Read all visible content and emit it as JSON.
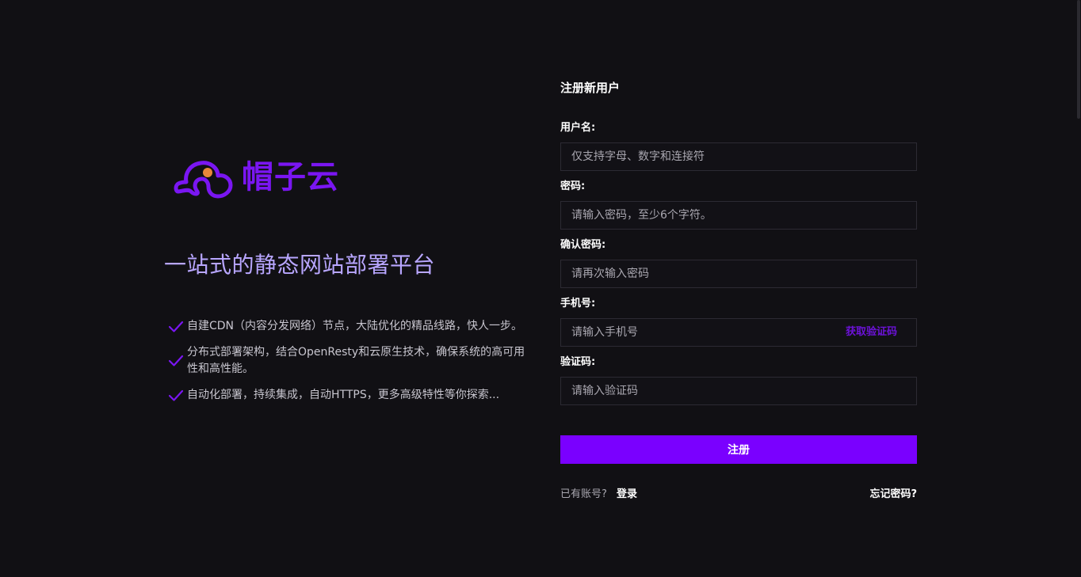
{
  "brand": {
    "name": "帽子云",
    "logo_icon": "cloud-hat-icon",
    "accent_color": "#7a16f2",
    "dot_color": "#e8873a"
  },
  "hero": {
    "headline": "一站式的静态网站部署平台",
    "features": [
      {
        "icon": "check-icon",
        "text": "自建CDN（内容分发网络）节点，大陆优化的精品线路，快人一步。"
      },
      {
        "icon": "check-icon",
        "text": "分布式部署架构，结合OpenResty和云原生技术，确保系统的高可用性和高性能。"
      },
      {
        "icon": "check-icon",
        "text": "自动化部署，持续集成，自动HTTPS，更多高级特性等你探索..."
      }
    ]
  },
  "form": {
    "title": "注册新用户",
    "username": {
      "label": "用户名:",
      "placeholder": "仅支持字母、数字和连接符",
      "value": ""
    },
    "password": {
      "label": "密码:",
      "placeholder": "请输入密码，至少6个字符。",
      "value": ""
    },
    "confirm_password": {
      "label": "确认密码:",
      "placeholder": "请再次输入密码",
      "value": ""
    },
    "phone": {
      "label": "手机号:",
      "placeholder": "请输入手机号",
      "value": "",
      "sms_button": "获取验证码"
    },
    "code": {
      "label": "验证码:",
      "placeholder": "请输入验证码",
      "value": ""
    },
    "submit_label": "注册",
    "submit_color": "#7a00ff",
    "have_account": "已有账号?",
    "login_label": "登录",
    "forgot_label": "忘记密码?"
  }
}
